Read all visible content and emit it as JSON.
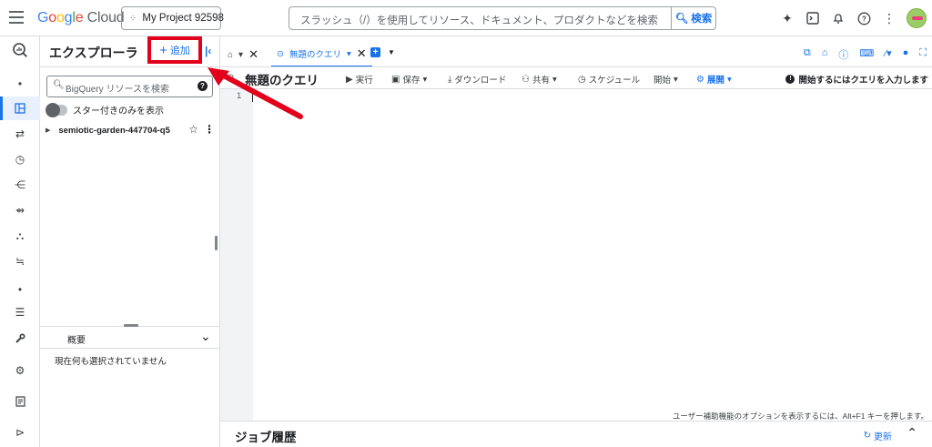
{
  "topbar": {
    "logo_parts": [
      "G",
      "o",
      "o",
      "g",
      "l",
      "e"
    ],
    "logo_cloud": "Cloud",
    "project_name": "My Project 92598",
    "search_placeholder": "スラッシュ（/）を使用してリソース、ドキュメント、プロダクトなどを検索",
    "search_button": "検索",
    "icons": [
      "gemini-icon",
      "cloud-shell-icon",
      "notifications-icon",
      "help-icon",
      "more-icon",
      "avatar"
    ]
  },
  "rail": {
    "icons": [
      "bigquery-logo-icon",
      "dot-icon",
      "studio-icon",
      "transfers-icon",
      "scheduled-queries-icon",
      "analytics-hub-icon",
      "dataform-icon",
      "graph-icon",
      "pipelines-icon",
      "dot-icon",
      "list-icon",
      "wrench-icon",
      "settings-icon",
      "release-notes-icon",
      "expand-icon"
    ]
  },
  "explorer": {
    "title": "エクスプローラ",
    "add_label": "追加",
    "search_placeholder": "BigQuery リソースを検索",
    "star_toggle_label": "スター付きのみを表示",
    "project_node": "semiotic-garden-447704-q5",
    "summary_title": "概要",
    "summary_empty": "現在何も選択されていません"
  },
  "main": {
    "tab_label": "無題のクエリ",
    "query_title": "無題のクエリ",
    "toolbar": {
      "run": "実行",
      "save": "保存",
      "download": "ダウンロード",
      "share": "共有",
      "schedule": "スケジュール",
      "open": "開始",
      "deploy": "展開"
    },
    "status": "開始するにはクエリを入力します",
    "line_number": "1",
    "a11y_hint": "ユーザー補助機能のオプションを表示するには、Alt+F1 キーを押します。",
    "jobs_title": "ジョブ履歴",
    "refresh_label": "更新"
  },
  "colors": {
    "accent": "#1a73e8",
    "annotation": "#e2001a"
  }
}
